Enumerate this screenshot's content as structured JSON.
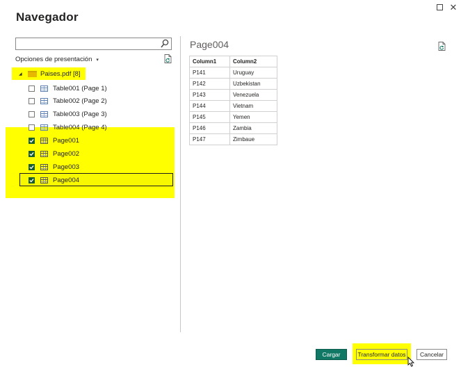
{
  "window": {
    "maximize_icon": "maximize-icon",
    "close_label": "✕"
  },
  "dialog": {
    "title": "Navegador"
  },
  "search": {
    "placeholder": "",
    "icon": "search-icon"
  },
  "display_options": {
    "label": "Opciones de presentación",
    "caret": "▾"
  },
  "tree": {
    "root": {
      "label": "Paises.pdf [8]",
      "expander": "◢"
    },
    "items": [
      {
        "label": "Table001 (Page 1)",
        "checked": false,
        "kind": "table"
      },
      {
        "label": "Table002 (Page 2)",
        "checked": false,
        "kind": "table"
      },
      {
        "label": "Table003 (Page 3)",
        "checked": false,
        "kind": "table"
      },
      {
        "label": "Table004 (Page 4)",
        "checked": false,
        "kind": "table"
      },
      {
        "label": "Page001",
        "checked": true,
        "kind": "page"
      },
      {
        "label": "Page002",
        "checked": true,
        "kind": "page"
      },
      {
        "label": "Page003",
        "checked": true,
        "kind": "page"
      },
      {
        "label": "Page004",
        "checked": true,
        "kind": "page",
        "selected": true
      }
    ]
  },
  "preview": {
    "title": "Page004",
    "columns": [
      "Column1",
      "Column2"
    ],
    "rows": [
      [
        "P141",
        "Uruguay"
      ],
      [
        "P142",
        "Uzbekistan"
      ],
      [
        "P143",
        "Venezuela"
      ],
      [
        "P144",
        "Vietnam"
      ],
      [
        "P145",
        "Yemen"
      ],
      [
        "P146",
        "Zambia"
      ],
      [
        "P147",
        "Zimbaue"
      ]
    ]
  },
  "footer": {
    "load_label": "Cargar",
    "transform_label": "Transformar datos",
    "cancel_label": "Cancelar"
  },
  "colors": {
    "highlight": "#ffff00",
    "load_button": "#117865",
    "checkbox_checked": "#1a5c2e"
  }
}
